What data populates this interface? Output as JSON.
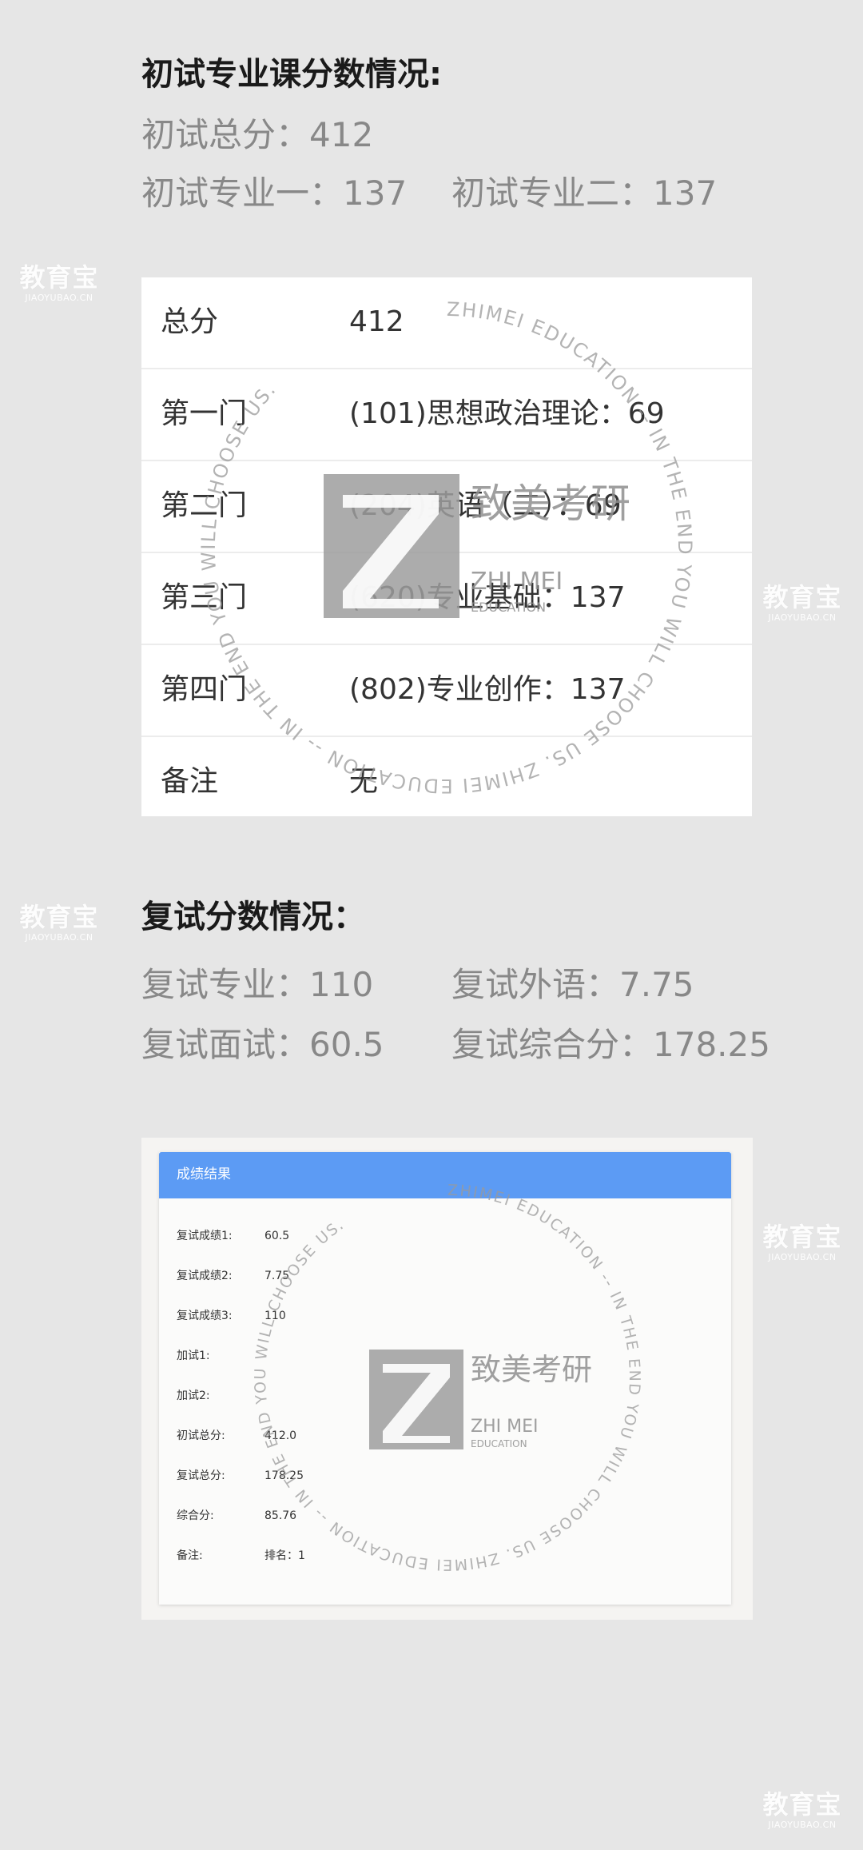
{
  "preliminary": {
    "heading": "初试专业课分数情况:",
    "total_line": "初试总分：412",
    "major1_line": "初试专业一：137",
    "major2_line": "初试专业二：137"
  },
  "score_table": {
    "rows": [
      {
        "label": "总分",
        "value": "412"
      },
      {
        "label": "第一门",
        "value": "(101)思想政治理论：69"
      },
      {
        "label": "第二门",
        "value": "(204)英语（二）：69"
      },
      {
        "label": "第三门",
        "value": "(620)专业基础：137"
      },
      {
        "label": "第四门",
        "value": "(802)专业创作：137"
      },
      {
        "label": "备注",
        "value": "无"
      }
    ]
  },
  "retest": {
    "heading": "复试分数情况：",
    "major_line": "复试专业：110",
    "foreign_line": "复试外语：7.75",
    "interview_line": "复试面试：60.5",
    "composite_line": "复试综合分：178.25"
  },
  "result_panel": {
    "header": "成绩结果",
    "rows": [
      {
        "label": "复试成绩1:",
        "value": "60.5"
      },
      {
        "label": "复试成绩2:",
        "value": "7.75"
      },
      {
        "label": "复试成绩3:",
        "value": "110"
      },
      {
        "label": "加试1:",
        "value": ""
      },
      {
        "label": "加试2:",
        "value": ""
      },
      {
        "label": "初试总分:",
        "value": "412.0"
      },
      {
        "label": "复试总分:",
        "value": "178.25"
      },
      {
        "label": "综合分:",
        "value": "85.76"
      },
      {
        "label": "备注:",
        "value": "排名：1"
      }
    ]
  },
  "watermark": {
    "ring_text": "ZHIMEI EDUCATION -- IN THE END YOU WILL CHOOSE US. ZHIMEI EDUCATION -- IN THE END YOU WILL CHOOSE US.",
    "logo_cn": "致美考研",
    "logo_en": "ZHI MEI",
    "logo_sub": "EDUCATION",
    "side_cn": "教育宝",
    "side_en": "JIAOYUBAO.CN"
  },
  "colors": {
    "background": "#e6e6e6",
    "header_blue": "#5c9bf4",
    "muted_text": "#888888"
  }
}
